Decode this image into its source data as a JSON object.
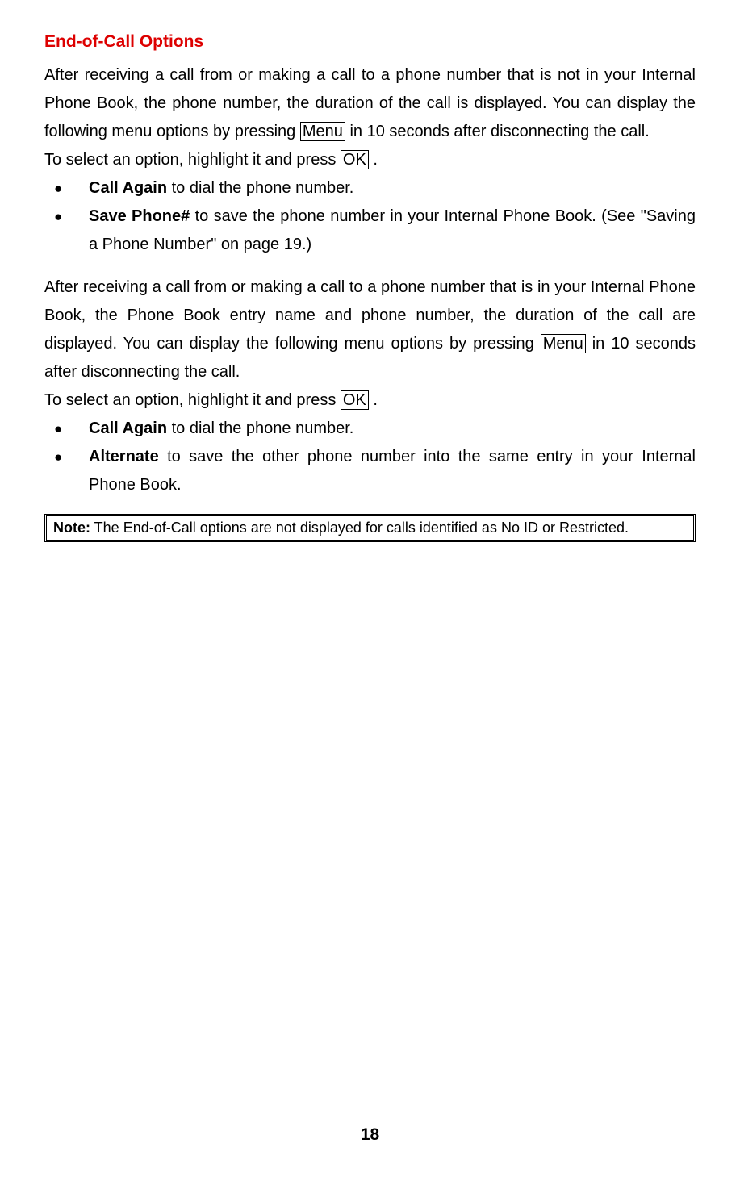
{
  "title": "End-of-Call Options",
  "para1_a": "After receiving a call from or making a call to a phone number that is not in your Internal Phone Book, the phone number, the duration of the call is displayed. You can display the following menu options by pressing ",
  "key_menu": "Menu",
  "para1_b": " in 10 seconds after disconnecting the call.",
  "select_a": "To select an option, highlight it and press ",
  "key_ok": "OK",
  "select_b": " .",
  "list1": {
    "item1_bold": "Call Again",
    "item1_rest": " to dial the phone number.",
    "item2_bold": "Save Phone#",
    "item2_rest": " to save the phone number in your Internal Phone Book. (See \"Saving a Phone Number\" on page 19.)"
  },
  "para2_a": "After receiving a call from or making a call to a phone number that is in your Internal Phone Book, the Phone Book entry name and phone number, the duration of the call are displayed. You can display the following menu options by pressing ",
  "para2_b": " in 10 seconds after disconnecting the call.",
  "list2": {
    "item1_bold": "Call Again",
    "item1_rest": " to dial the phone number.",
    "item2_bold": "Alternate",
    "item2_rest": " to save the other phone number into the same entry in your Internal Phone Book."
  },
  "note_bold": "Note:",
  "note_rest": " The End-of-Call options are not displayed for calls identified as No ID or Restricted.",
  "page_number": "18"
}
